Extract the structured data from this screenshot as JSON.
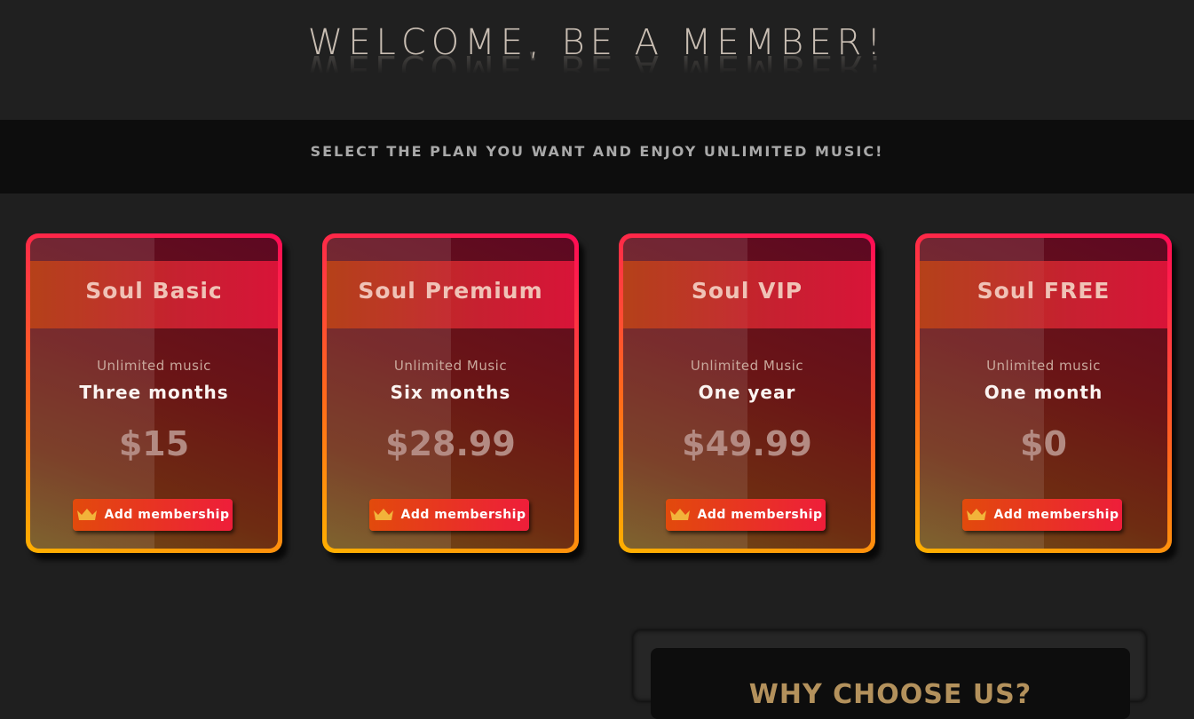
{
  "header": {
    "title": "WELCOME, BE A MEMBER!"
  },
  "banner": {
    "text": "SELECT THE PLAN YOU WANT AND ENJOY UNLIMITED MUSIC!"
  },
  "plans": [
    {
      "name": "Soul Basic",
      "subtitle": "Unlimited music",
      "duration": "Three months",
      "price": "$15",
      "button": "Add membership"
    },
    {
      "name": "Soul Premium",
      "subtitle": "Unlimited Music",
      "duration": "Six months",
      "price": "$28.99",
      "button": "Add membership"
    },
    {
      "name": "Soul VIP",
      "subtitle": "Unlimited Music",
      "duration": "One year",
      "price": "$49.99",
      "button": "Add membership"
    },
    {
      "name": "Soul FREE",
      "subtitle": "Unlimited music",
      "duration": "One month",
      "price": "$0",
      "button": "Add membership"
    }
  ],
  "why": {
    "title": "WHY CHOOSE US?"
  },
  "icons": {
    "button_icon": "crown-icon"
  },
  "colors": {
    "accent_orange": "#ff6a1a",
    "accent_pink": "#ff0a55",
    "accent_gold": "#ffb000",
    "background": "#1f1f1f"
  }
}
